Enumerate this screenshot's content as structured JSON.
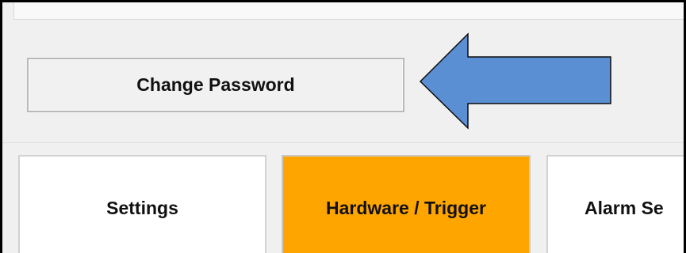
{
  "buttons": {
    "change_password": "Change Password"
  },
  "tabs": [
    {
      "label": "Settings",
      "active": false
    },
    {
      "label": "Hardware / Trigger",
      "active": true
    },
    {
      "label": "Alarm Se",
      "active": false
    }
  ],
  "colors": {
    "active_tab": "#ffa500",
    "arrow_fill": "#5a8fd3",
    "arrow_stroke": "#0d0d0d",
    "panel_background": "#f0f0f0"
  },
  "annotation": {
    "icon": "left-arrow-icon",
    "points_to": "change-password-button"
  }
}
